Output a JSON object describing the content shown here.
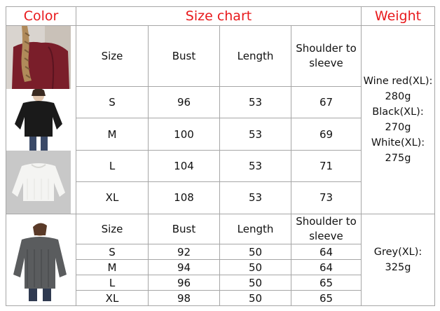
{
  "header": {
    "color": "Color",
    "size_chart": "Size chart",
    "weight": "Weight"
  },
  "section1": {
    "columns": [
      "Size",
      "Bust",
      "Length",
      "Shoulder to sleeve"
    ],
    "rows": [
      [
        "S",
        "96",
        "53",
        "67"
      ],
      [
        "M",
        "100",
        "53",
        "69"
      ],
      [
        "L",
        "104",
        "53",
        "71"
      ],
      [
        "XL",
        "108",
        "53",
        "73"
      ]
    ],
    "weights": [
      "Wine red(XL):",
      "280g",
      "Black(XL):",
      "270g",
      "White(XL):",
      "275g"
    ],
    "photos": [
      {
        "name": "wine-red-sweater-photo",
        "color": "#7a1e2a"
      },
      {
        "name": "black-sweater-photo",
        "color": "#1a1a1a"
      },
      {
        "name": "white-sweater-photo",
        "color": "#f2f2f0"
      }
    ]
  },
  "section2": {
    "columns": [
      "Size",
      "Bust",
      "Length",
      "Shoulder to sleeve"
    ],
    "rows": [
      [
        "S",
        "92",
        "50",
        "64"
      ],
      [
        "M",
        "94",
        "50",
        "64"
      ],
      [
        "L",
        "96",
        "50",
        "65"
      ],
      [
        "XL",
        "98",
        "50",
        "65"
      ]
    ],
    "weights": [
      "Grey(XL):",
      "325g"
    ],
    "photos": [
      {
        "name": "grey-sweater-photo",
        "color": "#5a5c5e"
      }
    ]
  }
}
